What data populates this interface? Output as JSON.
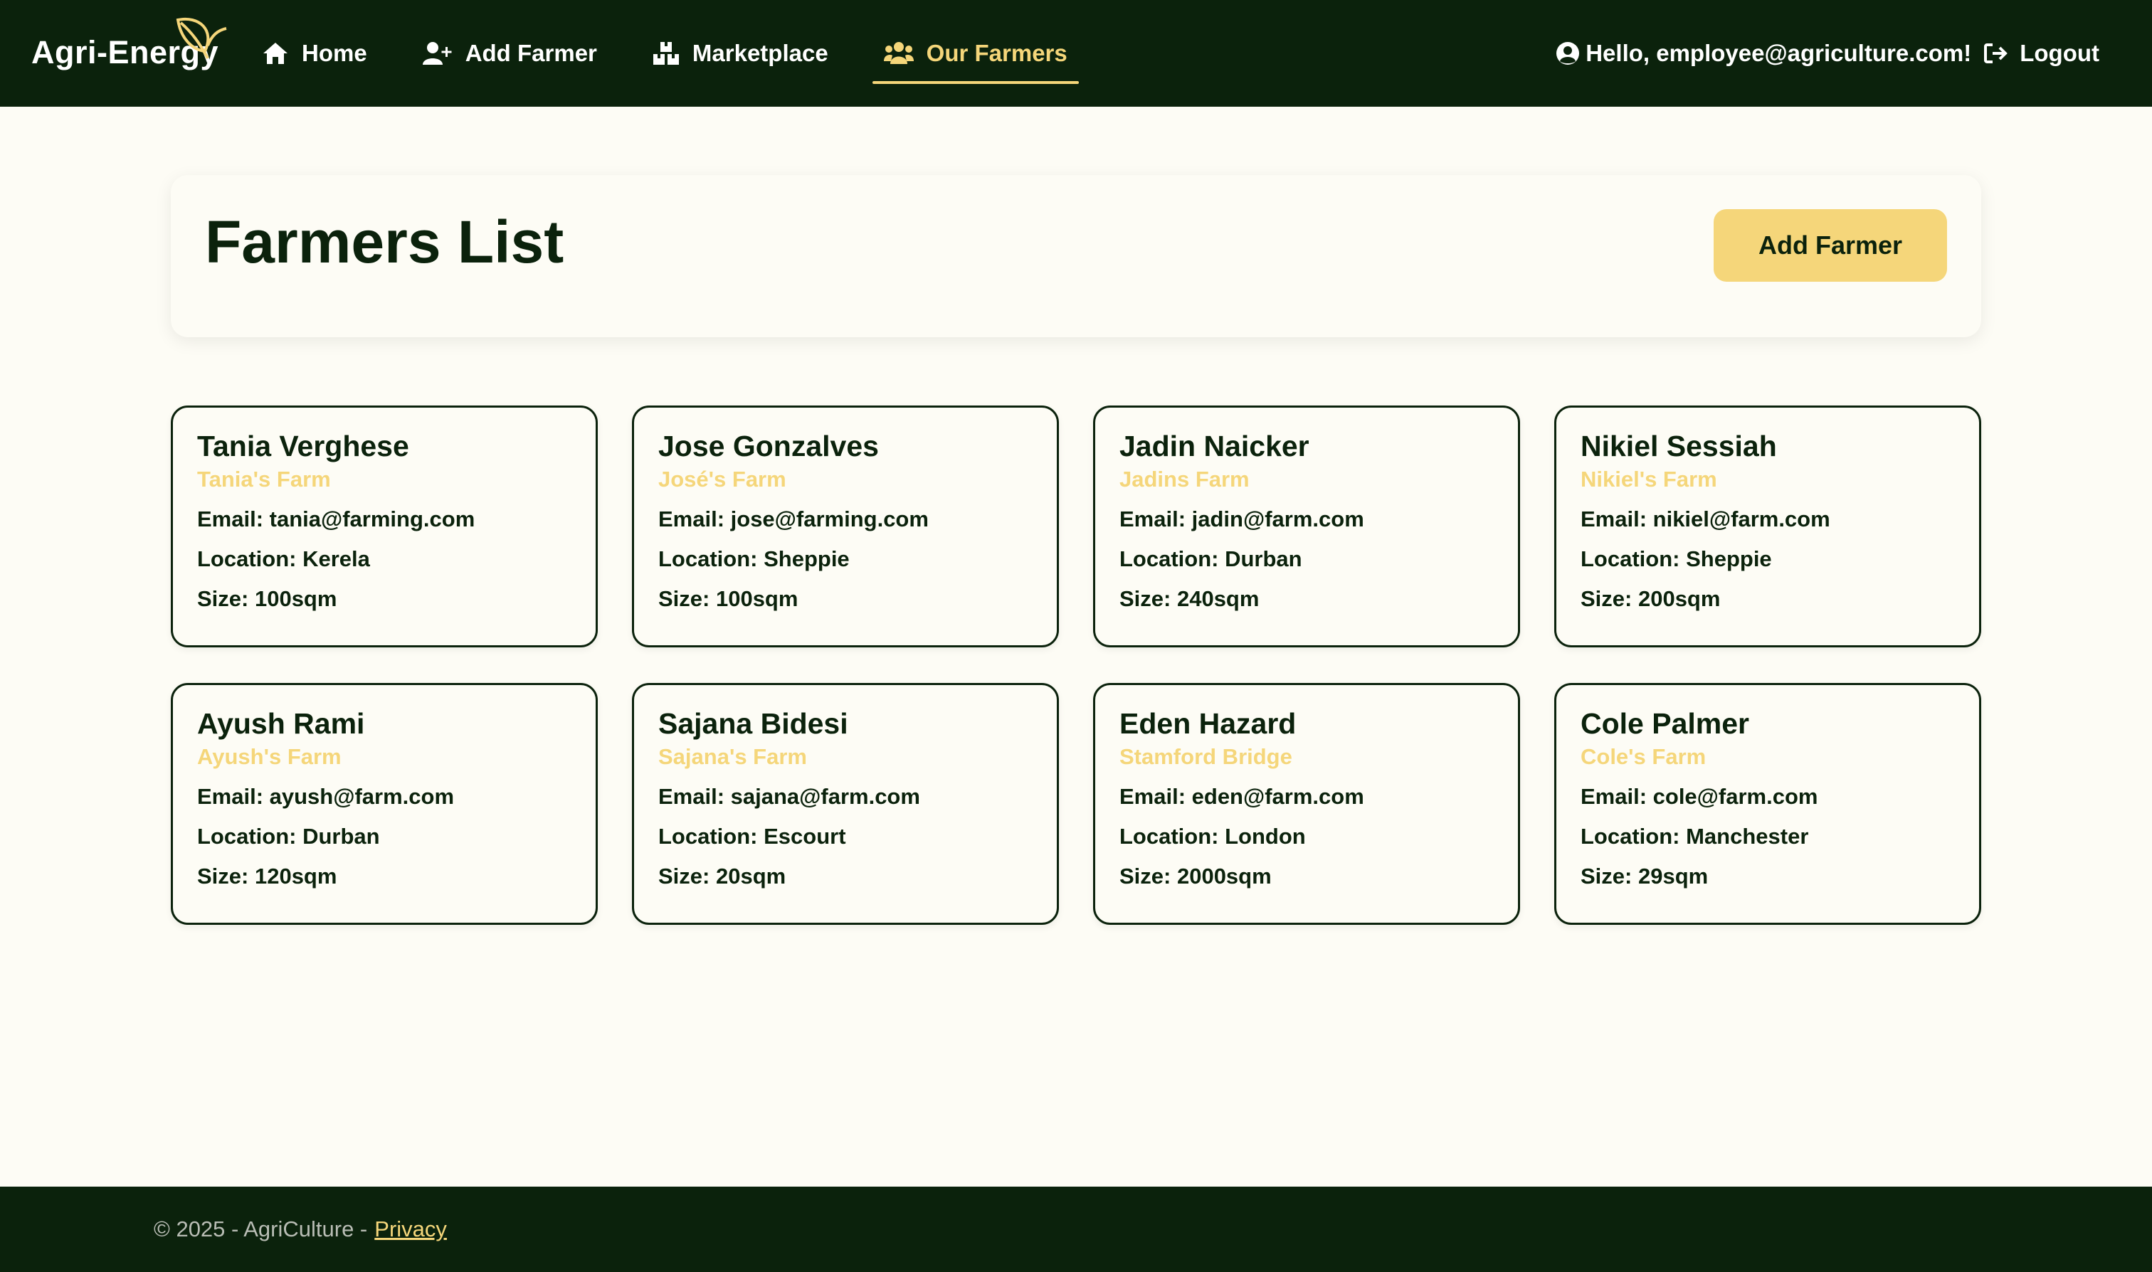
{
  "brand": {
    "name": "Agri-Energy"
  },
  "nav": {
    "items": [
      {
        "label": "Home",
        "icon": "home-icon"
      },
      {
        "label": "Add Farmer",
        "icon": "user-plus-icon"
      },
      {
        "label": "Marketplace",
        "icon": "boxes-icon"
      },
      {
        "label": "Our Farmers",
        "icon": "users-icon",
        "active": true
      }
    ],
    "greeting": "Hello, employee@agriculture.com!",
    "logout": "Logout"
  },
  "page": {
    "title": "Farmers List",
    "add_button": "Add Farmer"
  },
  "farmers": [
    {
      "name": "Tania Verghese",
      "farm": "Tania's Farm",
      "email": "Email: tania@farming.com",
      "location": "Location: Kerela",
      "size": "Size: 100sqm"
    },
    {
      "name": "Jose Gonzalves",
      "farm": "José's Farm",
      "email": "Email: jose@farming.com",
      "location": "Location: Sheppie",
      "size": "Size: 100sqm"
    },
    {
      "name": "Jadin Naicker",
      "farm": "Jadins Farm",
      "email": "Email: jadin@farm.com",
      "location": "Location: Durban",
      "size": "Size: 240sqm"
    },
    {
      "name": "Nikiel Sessiah",
      "farm": "Nikiel's Farm",
      "email": "Email: nikiel@farm.com",
      "location": "Location: Sheppie",
      "size": "Size: 200sqm"
    },
    {
      "name": "Ayush Rami",
      "farm": "Ayush's Farm",
      "email": "Email: ayush@farm.com",
      "location": "Location: Durban",
      "size": "Size: 120sqm"
    },
    {
      "name": "Sajana Bidesi",
      "farm": "Sajana's Farm",
      "email": "Email: sajana@farm.com",
      "location": "Location: Escourt",
      "size": "Size: 20sqm"
    },
    {
      "name": "Eden Hazard",
      "farm": "Stamford Bridge",
      "email": "Email: eden@farm.com",
      "location": "Location: London",
      "size": "Size: 2000sqm"
    },
    {
      "name": "Cole Palmer",
      "farm": "Cole's Farm",
      "email": "Email: cole@farm.com",
      "location": "Location: Manchester",
      "size": "Size: 29sqm"
    }
  ],
  "footer": {
    "copyright": "© 2025 - AgriCulture -",
    "privacy": "Privacy"
  },
  "colors": {
    "nav_bg": "#0b220c",
    "accent": "#f5d67a",
    "page_bg": "#fdfcf5"
  }
}
